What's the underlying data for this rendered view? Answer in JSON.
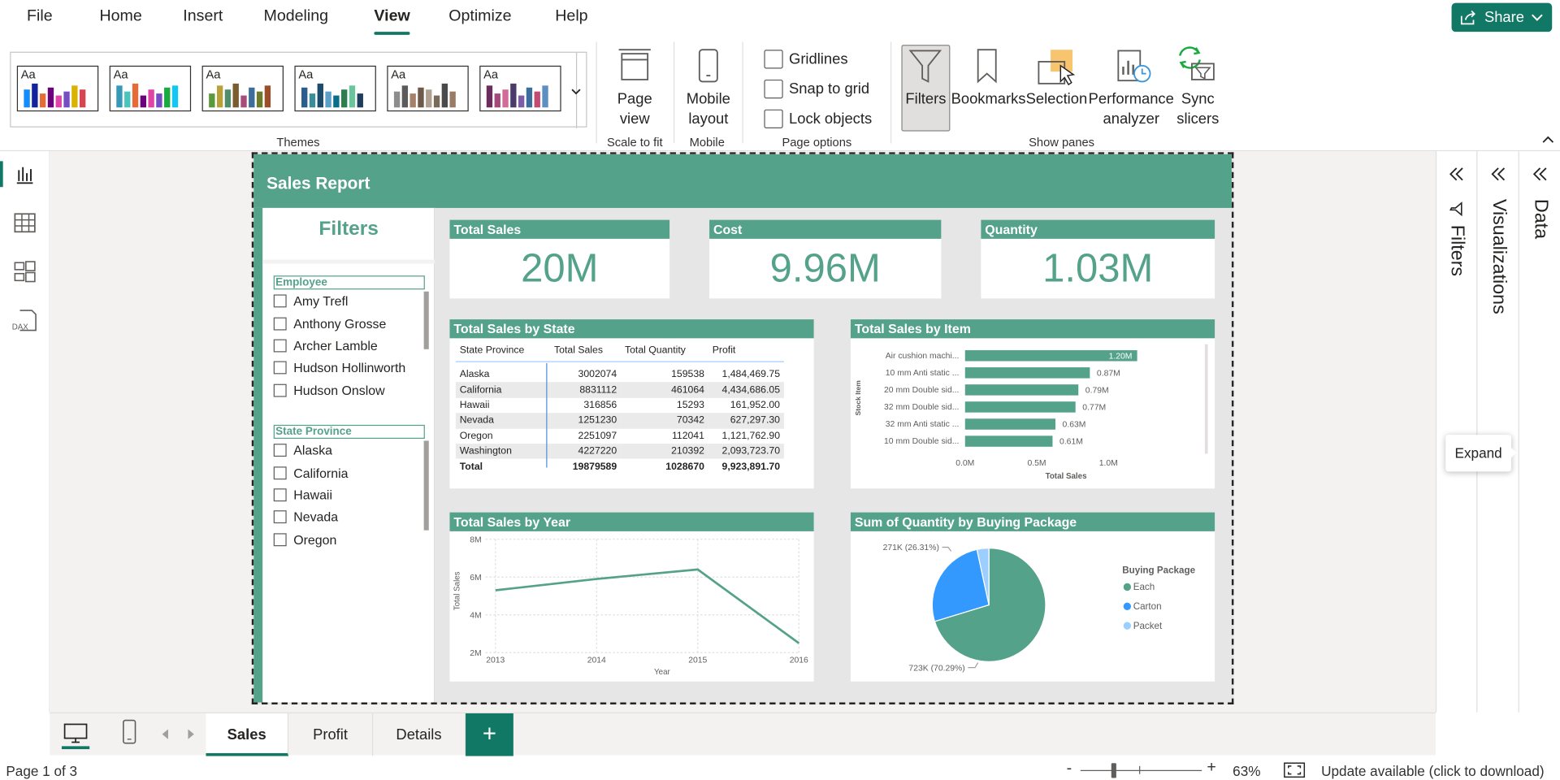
{
  "menu": {
    "items": [
      "File",
      "Home",
      "Insert",
      "Modeling",
      "View",
      "Optimize",
      "Help"
    ],
    "active": "View",
    "share": "Share"
  },
  "ribbon": {
    "themes_label": "Themes",
    "theme_sample": "Aa",
    "page_view": "Page view",
    "scale_to_fit": "Scale to fit",
    "mobile_layout": "Mobile layout",
    "mobile": "Mobile",
    "gridlines": "Gridlines",
    "snap_to_grid": "Snap to grid",
    "lock_objects": "Lock objects",
    "page_options": "Page options",
    "filters": "Filters",
    "bookmarks": "Bookmarks",
    "selection": "Selection",
    "performance": "Performance analyzer",
    "sync_slicers": "Sync slicers",
    "show_panes": "Show panes"
  },
  "report": {
    "title": "Sales Report",
    "filters_title": "Filters",
    "employee_header": "Employee",
    "employees": [
      "Amy Trefl",
      "Anthony Grosse",
      "Archer Lamble",
      "Hudson Hollinworth",
      "Hudson Onslow"
    ],
    "state_header": "State Province",
    "states": [
      "Alaska",
      "California",
      "Hawaii",
      "Nevada",
      "Oregon"
    ],
    "kpis": [
      {
        "title": "Total Sales",
        "value": "20M"
      },
      {
        "title": "Cost",
        "value": "9.96M"
      },
      {
        "title": "Quantity",
        "value": "1.03M"
      }
    ],
    "table": {
      "title": "Total Sales by State",
      "headers": [
        "State Province",
        "Total Sales",
        "Total Quantity",
        "Profit"
      ],
      "rows": [
        [
          "Alaska",
          "3002074",
          "159538",
          "1,484,469.75"
        ],
        [
          "California",
          "8831112",
          "461064",
          "4,434,686.05"
        ],
        [
          "Hawaii",
          "316856",
          "15293",
          "161,952.00"
        ],
        [
          "Nevada",
          "1251230",
          "70342",
          "627,297.30"
        ],
        [
          "Oregon",
          "2251097",
          "112041",
          "1,121,762.90"
        ],
        [
          "Washington",
          "4227220",
          "210392",
          "2,093,723.70"
        ]
      ],
      "total": [
        "Total",
        "19879589",
        "1028670",
        "9,923,891.70"
      ]
    },
    "bar_title": "Total Sales by Item",
    "line_title": "Total Sales by Year",
    "pie_title": "Sum of Quantity by Buying Package"
  },
  "chart_data": [
    {
      "type": "bar",
      "title": "Total Sales by Item",
      "orientation": "horizontal",
      "categories": [
        "Air cushion machi...",
        "10 mm Anti static ...",
        "20 mm Double sid...",
        "32 mm Double sid...",
        "32 mm Anti static ...",
        "10 mm Double sid..."
      ],
      "values": [
        1.2,
        0.87,
        0.79,
        0.77,
        0.63,
        0.61
      ],
      "value_labels": [
        "1.20M",
        "0.87M",
        "0.79M",
        "0.77M",
        "0.63M",
        "0.61M"
      ],
      "xlabel": "Total Sales",
      "ylabel": "Stock Item",
      "xticks": [
        "0.0M",
        "0.5M",
        "1.0M"
      ],
      "xlim": [
        0,
        1.2
      ],
      "color": "#55a28b"
    },
    {
      "type": "line",
      "title": "Total Sales by Year",
      "x": [
        "2013",
        "2014",
        "2015",
        "2016"
      ],
      "values": [
        5.3,
        5.9,
        6.4,
        2.5
      ],
      "xlabel": "Year",
      "ylabel": "Total Sales",
      "yticks": [
        "2M",
        "4M",
        "6M",
        "8M"
      ],
      "ylim": [
        2,
        8
      ],
      "grid": true,
      "color": "#55a28b"
    },
    {
      "type": "pie",
      "title": "Sum of Quantity by Buying Package",
      "legend_title": "Buying Package",
      "legend_position": "right",
      "slices": [
        {
          "name": "Each",
          "value": 70.29,
          "color": "#55a28b"
        },
        {
          "name": "Carton",
          "value": 26.31,
          "color": "#3399ff"
        },
        {
          "name": "Packet",
          "value": 3.4,
          "color": "#9ccfff"
        }
      ],
      "labels": [
        "723K (70.29%)",
        "271K (26.31%)"
      ]
    }
  ],
  "panes": {
    "filters": "Filters",
    "visualizations": "Visualizations",
    "data": "Data",
    "tooltip": "Expand"
  },
  "tabs": {
    "items": [
      "Sales",
      "Profit",
      "Details"
    ],
    "active": "Sales",
    "add": "+"
  },
  "status": {
    "page": "Page 1 of 3",
    "zoom": "63%",
    "update": "Update available (click to download)"
  }
}
